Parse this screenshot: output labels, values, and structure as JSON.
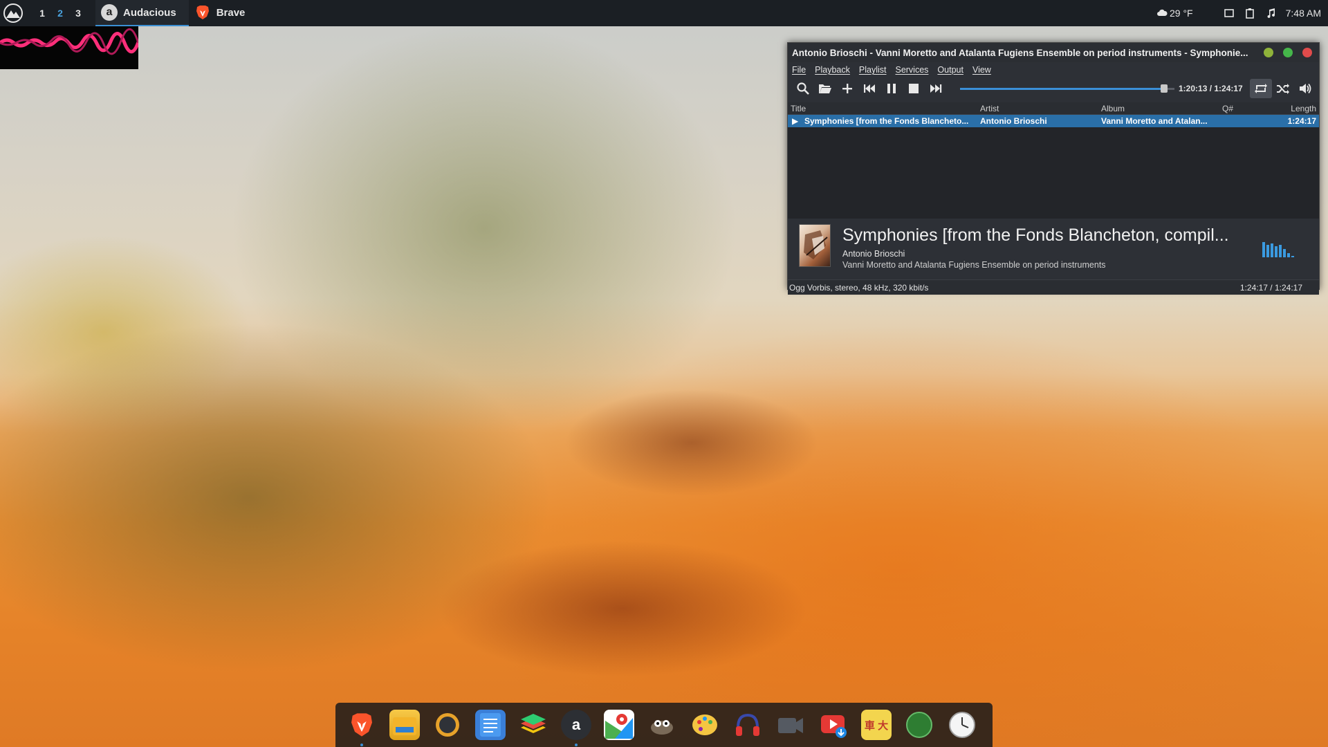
{
  "panel": {
    "workspaces": [
      "1",
      "2",
      "3"
    ],
    "active_workspace": "2",
    "tasks": [
      {
        "label": "Audacious",
        "icon": "audacious-icon"
      },
      {
        "label": "Brave",
        "icon": "brave-lion-icon"
      }
    ],
    "weather": "29 °F",
    "clock": "7:48 AM"
  },
  "window": {
    "title": "Antonio Brioschi - Vanni Moretto and Atalanta Fugiens Ensemble on period instruments - Symphonie...",
    "menu": [
      "File",
      "Playback",
      "Playlist",
      "Services",
      "Output",
      "View"
    ],
    "time_display": "1:20:13 / 1:24:17",
    "seek_progress": 0.95,
    "columns": {
      "title": "Title",
      "artist": "Artist",
      "album": "Album",
      "queue": "Q#",
      "length": "Length"
    },
    "playlist": [
      {
        "title": "Symphonies [from the Fonds Blancheto...",
        "artist": "Antonio Brioschi",
        "album": "Vanni Moretto and Atalan...",
        "length": "1:24:17"
      }
    ],
    "now_playing": {
      "title": "Symphonies [from the Fonds Blancheton, compil...",
      "artist": "Antonio Brioschi",
      "album": "Vanni Moretto and Atalanta Fugiens Ensemble on period instruments"
    },
    "status": {
      "format": "Ogg Vorbis, stereo, 48 kHz, 320 kbit/s",
      "time": "1:24:17 / 1:24:17"
    },
    "accent_color": "#2a6fa8"
  },
  "dock": {
    "apps": [
      "brave-icon",
      "files-icon",
      "system-monitor-icon",
      "notes-icon",
      "layers-icon",
      "audacious-icon",
      "maps-icon",
      "gimp-icon",
      "palette-icon",
      "headphones-icon",
      "video-recorder-icon",
      "youtube-downloader-icon",
      "dictionary-icon",
      "green-orb-icon",
      "clock-app-icon"
    ]
  }
}
